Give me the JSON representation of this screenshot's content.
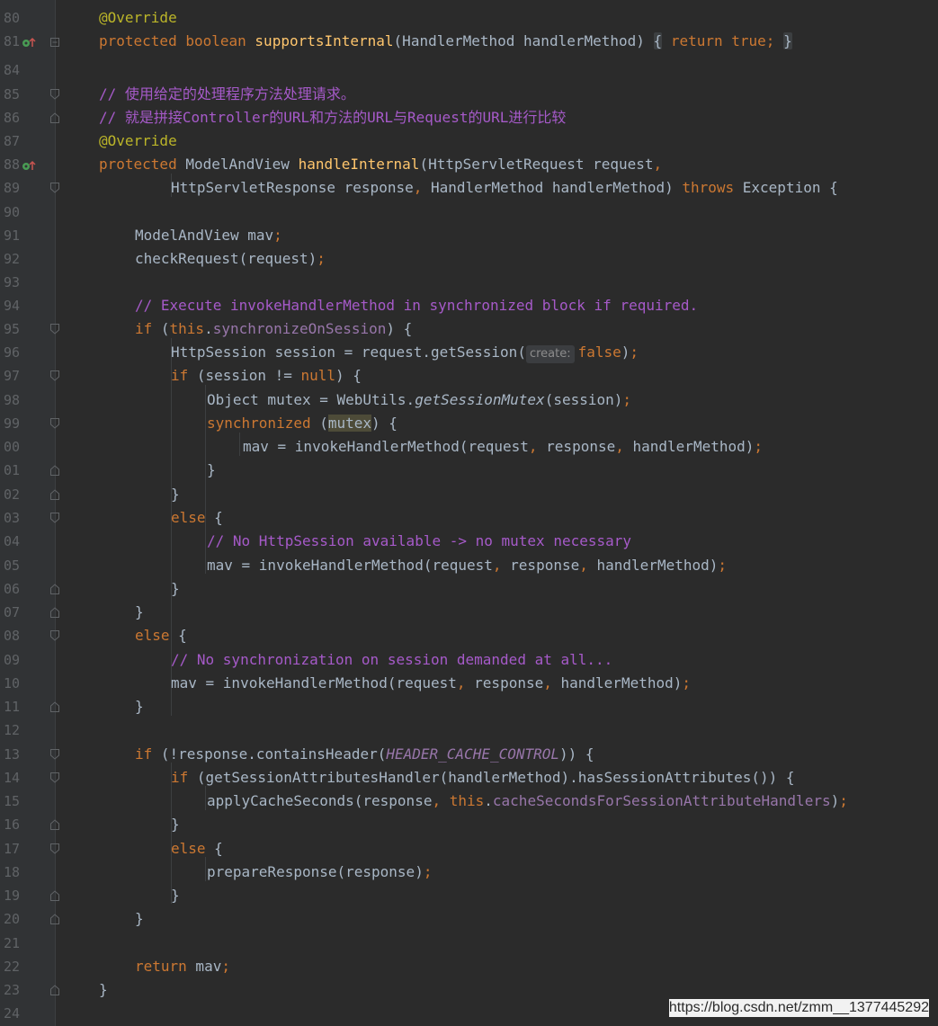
{
  "editor": {
    "line_numbers": [
      "80",
      "81",
      "84",
      "85",
      "86",
      "87",
      "88",
      "89",
      "90",
      "91",
      "92",
      "93",
      "94",
      "95",
      "96",
      "97",
      "98",
      "99",
      "00",
      "01",
      "02",
      "03",
      "04",
      "05",
      "06",
      "07",
      "08",
      "09",
      "10",
      "11",
      "12",
      "13",
      "14",
      "15",
      "16",
      "17",
      "18",
      "19",
      "20",
      "21",
      "22",
      "23",
      "24"
    ],
    "lines": {
      "l80": {
        "override": "@Override"
      },
      "l81": {
        "protected": "protected",
        "boolean": "boolean",
        "name": "supportsInternal",
        "params": "(HandlerMethod handlerMethod)",
        "open": "{",
        "ret": "return",
        "true": "true",
        "semi": ";",
        "close": "}"
      },
      "l85": {
        "comment": "// 使用给定的处理程序方法处理请求。"
      },
      "l86": {
        "comment": "// 就是拼接Controller的URL和方法的URL与Request的URL进行比较"
      },
      "l87": {
        "override": "@Override"
      },
      "l88": {
        "protected": "protected",
        "type": "ModelAndView",
        "name": "handleInternal",
        "rest": "(HttpServletRequest request",
        "comma": ","
      },
      "l89": {
        "a": "HttpServletResponse response",
        "comma": ",",
        "b": " HandlerMethod handlerMethod) ",
        "throws": "throws",
        "c": " Exception {"
      },
      "l91": {
        "text": "ModelAndView mav",
        "semi": ";"
      },
      "l92": {
        "text": "checkRequest(request)",
        "semi": ";"
      },
      "l94": {
        "comment": "// Execute invokeHandlerMethod in synchronized block if required."
      },
      "l95": {
        "if": "if",
        "p1": " (",
        "this": "this",
        "dot": ".",
        "field": "synchronizeOnSession",
        "p2": ") {"
      },
      "l96": {
        "a": "HttpSession session = request.getSession(",
        "hint": "create:",
        "false": "false",
        "b": ")",
        "semi": ";"
      },
      "l97": {
        "if": "if",
        "a": " (session != ",
        "null": "null",
        "b": ") {"
      },
      "l98": {
        "a": "Object mutex = WebUtils.",
        "method": "getSessionMutex",
        "b": "(session)",
        "semi": ";"
      },
      "l99": {
        "sync": "synchronized",
        "a": " (",
        "mutex": "mutex",
        "b": ") {"
      },
      "l00": {
        "a": "mav = invokeHandlerMethod(request",
        "c1": ",",
        "b": " response",
        "c2": ",",
        "c": " handlerMethod)",
        "semi": ";"
      },
      "l01": {
        "text": "}"
      },
      "l02": {
        "text": "}"
      },
      "l03": {
        "else": "else",
        "a": " {"
      },
      "l04": {
        "comment": "// No HttpSession available -> no mutex necessary"
      },
      "l05": {
        "a": "mav = invokeHandlerMethod(request",
        "c1": ",",
        "b": " response",
        "c2": ",",
        "c": " handlerMethod)",
        "semi": ";"
      },
      "l06": {
        "text": "}"
      },
      "l07": {
        "text": "}"
      },
      "l08": {
        "else": "else",
        "a": " {"
      },
      "l09": {
        "comment": "// No synchronization on session demanded at all..."
      },
      "l10": {
        "a": "mav = invokeHandlerMethod(request",
        "c1": ",",
        "b": " response",
        "c2": ",",
        "c": " handlerMethod)",
        "semi": ";"
      },
      "l11": {
        "text": "}"
      },
      "l13": {
        "if": "if",
        "a": " (!response.containsHeader(",
        "const": "HEADER_CACHE_CONTROL",
        "b": ")) {"
      },
      "l14": {
        "if": "if",
        "a": " (getSessionAttributesHandler(handlerMethod).hasSessionAttributes()) {"
      },
      "l15": {
        "a": "applyCacheSeconds(response",
        "comma": ",",
        "sp": " ",
        "this": "this",
        "dot": ".",
        "field": "cacheSecondsForSessionAttributeHandlers",
        "b": ")",
        "semi": ";"
      },
      "l16": {
        "text": "}"
      },
      "l17": {
        "else": "else",
        "a": " {"
      },
      "l18": {
        "a": "prepareResponse(response)",
        "semi": ";"
      },
      "l19": {
        "text": "}"
      },
      "l20": {
        "text": "}"
      },
      "l22": {
        "ret": "return",
        "a": " mav",
        "semi": ";"
      },
      "l23": {
        "text": "}"
      }
    }
  },
  "watermark": "https://blog.csdn.net/zmm__1377445292",
  "colors": {
    "background": "#2b2b2b",
    "keyword": "#cc7832",
    "annotation": "#bbb529",
    "method": "#ffc66d",
    "comment": "#a65ac9",
    "field": "#9876aa"
  }
}
